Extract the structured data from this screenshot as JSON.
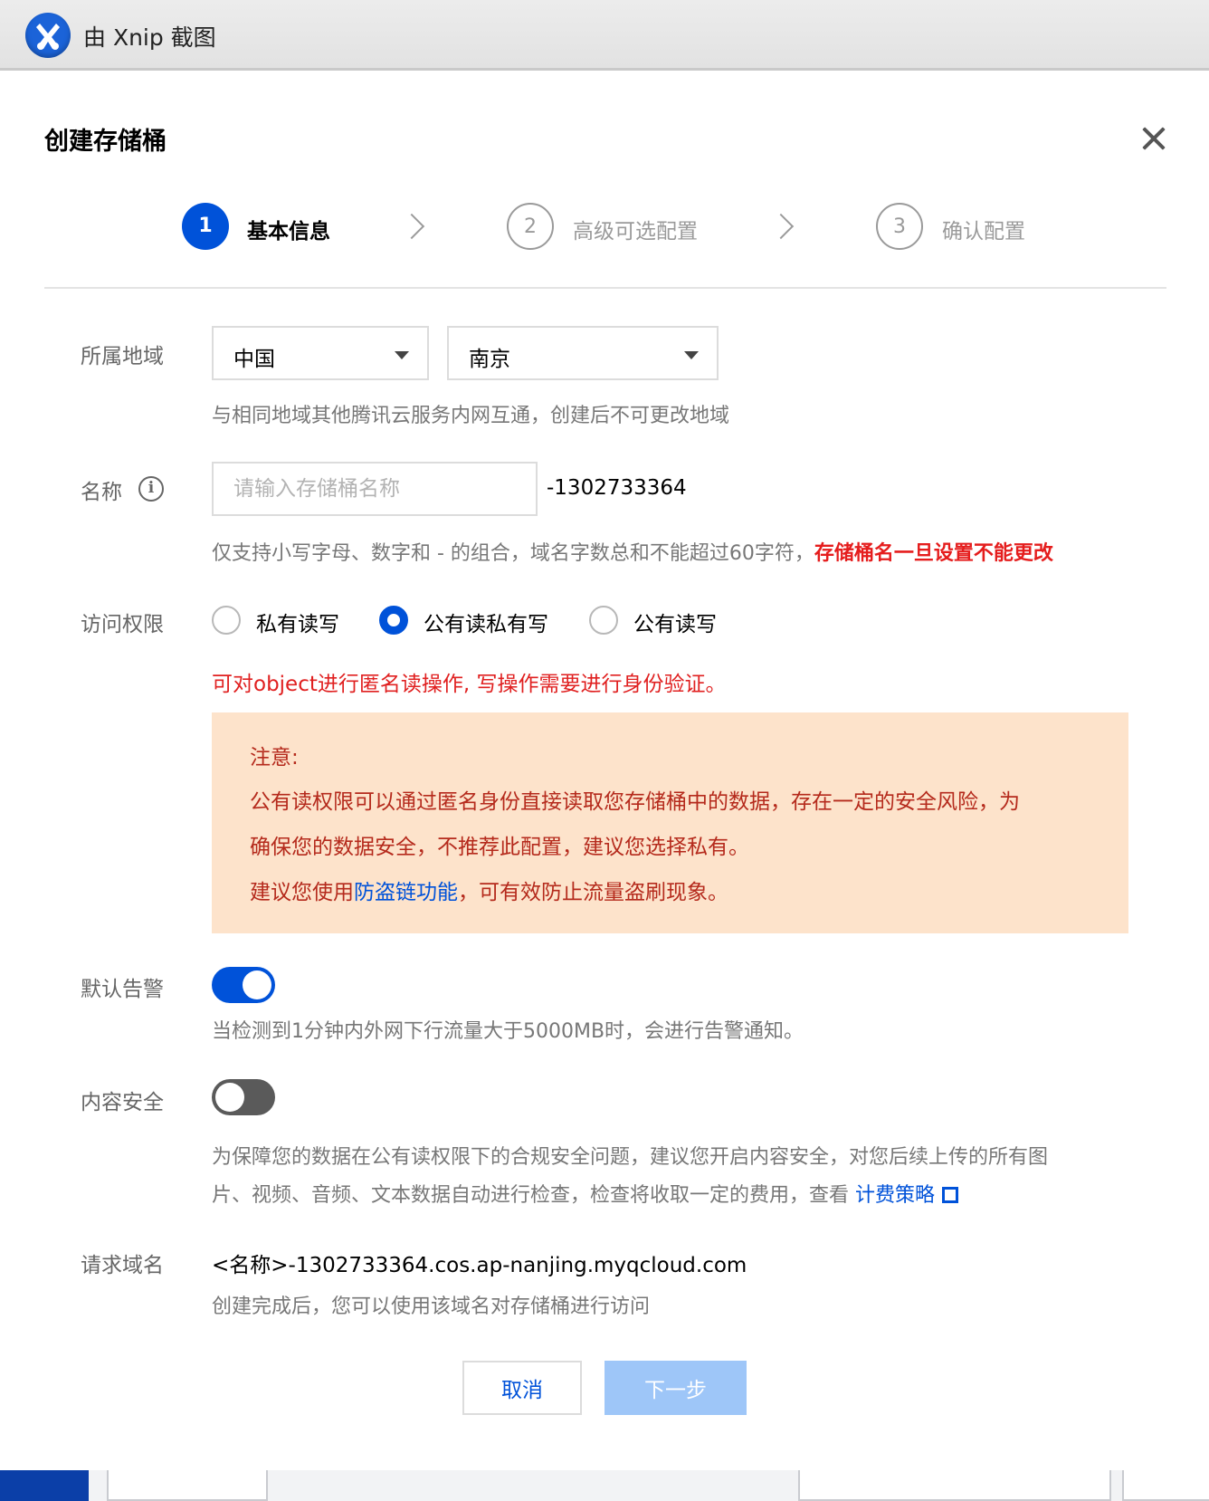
{
  "titlebar": {
    "text": "由 Xnip 截图",
    "icon": "xnip-logo-icon"
  },
  "dialog": {
    "title": "创建存储桶",
    "close_icon": "close-icon"
  },
  "steps": [
    {
      "number": "1",
      "label": "基本信息",
      "active": true
    },
    {
      "number": "2",
      "label": "高级可选配置",
      "active": false
    },
    {
      "number": "3",
      "label": "确认配置",
      "active": false
    }
  ],
  "region": {
    "label": "所属地域",
    "country": "中国",
    "city": "南京",
    "help": "与相同地域其他腾讯云服务内网互通，创建后不可更改地域"
  },
  "name": {
    "label": "名称",
    "placeholder": "请输入存储桶名称",
    "value": "",
    "suffix": "-1302733364",
    "help": "仅支持小写字母、数字和 - 的组合，域名字数总和不能超过60字符，",
    "warning": "存储桶名一旦设置不能更改"
  },
  "access": {
    "label": "访问权限",
    "options": [
      "私有读写",
      "公有读私有写",
      "公有读写"
    ],
    "selected": "公有读私有写",
    "description": "可对object进行匿名读操作, 写操作需要进行身份验证。"
  },
  "notice": {
    "title": "注意:",
    "line1": "公有读权限可以通过匿名身份直接读取您存储桶中的数据，存在一定的安全风险，为",
    "line2": "确保您的数据安全，不推荐此配置，建议您选择私有。",
    "line3_prefix": "建议您使用",
    "line3_link": "防盗链功能",
    "line3_suffix": "，可有效防止流量盗刷现象。"
  },
  "alarm": {
    "label": "默认告警",
    "enabled": true,
    "help": "当检测到1分钟内外网下行流量大于5000MB时，会进行告警通知。"
  },
  "content_security": {
    "label": "内容安全",
    "enabled": false,
    "help_line1": "为保障您的数据在公有读权限下的合规安全问题，建议您开启内容安全，对您后续上传的所有图",
    "help_line2": "片、视频、音频、文本数据自动进行检查，检查将收取一定的费用，查看 ",
    "link": "计费策略",
    "link_icon": "external-link-icon"
  },
  "domain": {
    "label": "请求域名",
    "value": "<名称>-1302733364.cos.ap-nanjing.myqcloud.com",
    "help": "创建完成后，您可以使用该域名对存储桶进行访问"
  },
  "buttons": {
    "cancel": "取消",
    "next": "下一步"
  },
  "colors": {
    "primary": "#0052d9",
    "danger": "#e51d1d",
    "notice_bg": "#fde3cb",
    "notice_text": "#b52a1c",
    "disabled_btn": "#9ec6f8"
  }
}
